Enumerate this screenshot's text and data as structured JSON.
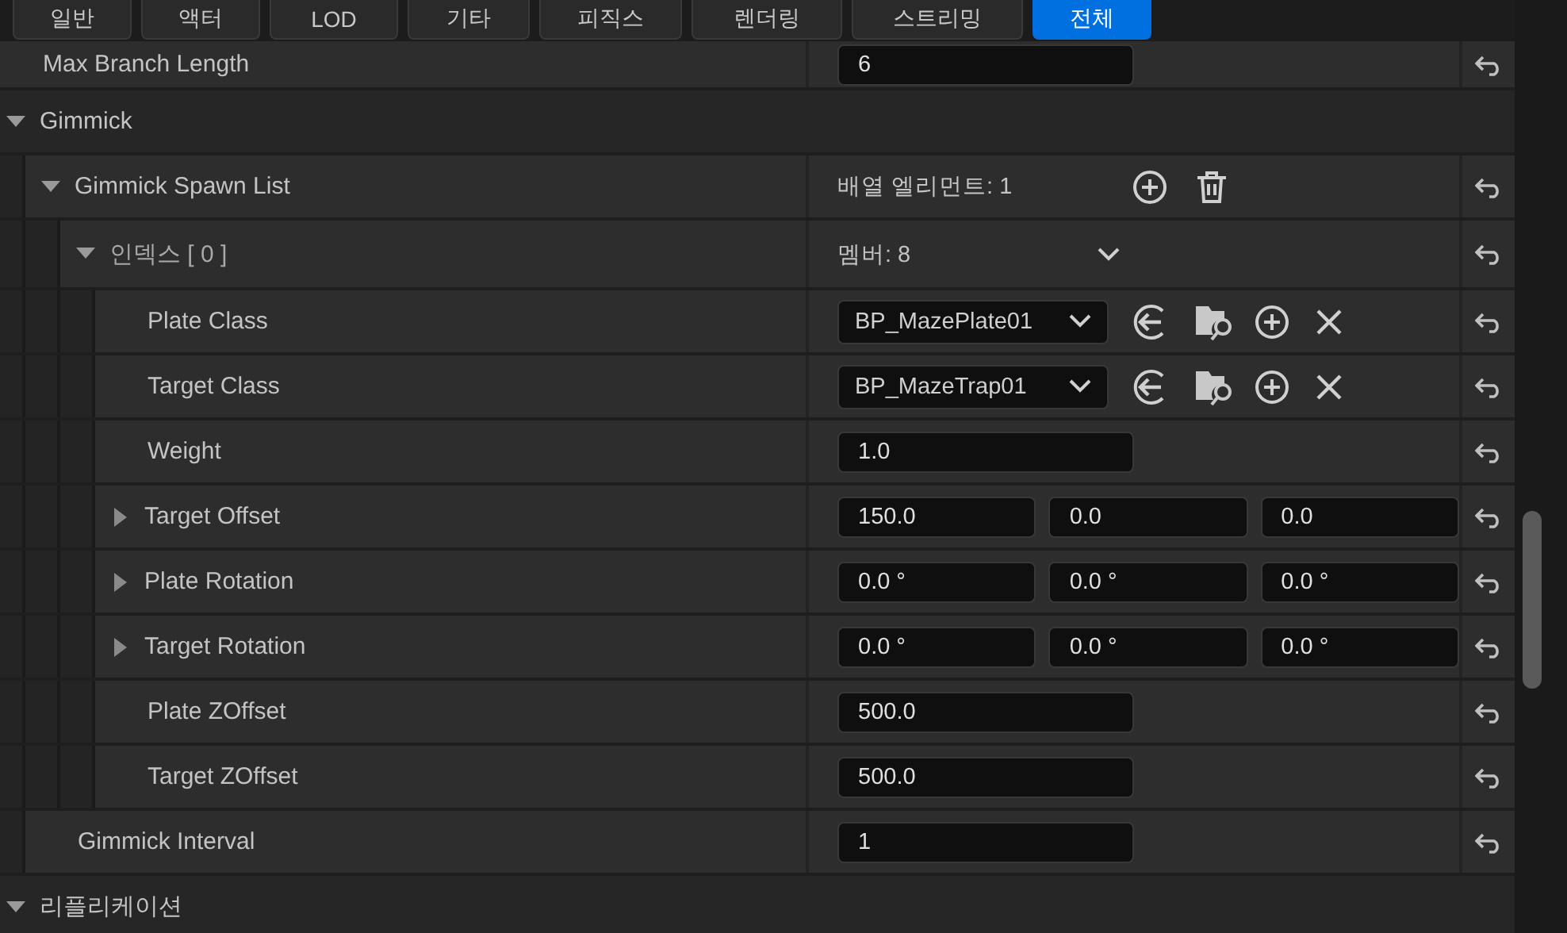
{
  "tabs": [
    {
      "label": "일반",
      "selected": false
    },
    {
      "label": "액터",
      "selected": false
    },
    {
      "label": "LOD",
      "selected": false
    },
    {
      "label": "기타",
      "selected": false
    },
    {
      "label": "피직스",
      "selected": false
    },
    {
      "label": "렌더링",
      "selected": false
    },
    {
      "label": "스트리밍",
      "selected": false
    },
    {
      "label": "전체",
      "selected": true
    }
  ],
  "rows": [
    {
      "kind": "property",
      "name": "Max Branch Length",
      "editor": {
        "kind": "number",
        "value": "6"
      }
    },
    {
      "kind": "category",
      "name": "Gimmick",
      "expanded": true,
      "children": [
        {
          "kind": "property",
          "name": "Gimmick Spawn List",
          "expanded": true,
          "editor": {
            "kind": "array",
            "text": "배열 엘리먼트: 1"
          },
          "children": [
            {
              "kind": "property",
              "name": "인덱스 [ 0 ]",
              "expanded": true,
              "editor": {
                "kind": "struct",
                "text": "멤버: 8"
              },
              "children": [
                {
                  "kind": "property",
                  "name": "Plate Class",
                  "editor": {
                    "kind": "class",
                    "value": "BP_MazePlate01"
                  }
                },
                {
                  "kind": "property",
                  "name": "Target Class",
                  "editor": {
                    "kind": "class",
                    "value": "BP_MazeTrap01"
                  }
                },
                {
                  "kind": "property",
                  "name": "Weight",
                  "editor": {
                    "kind": "number",
                    "value": "1.0"
                  }
                },
                {
                  "kind": "property",
                  "name": "Target Offset",
                  "expanded": false,
                  "editor": {
                    "kind": "vector",
                    "values": [
                      "150.0",
                      "0.0",
                      "0.0"
                    ]
                  }
                },
                {
                  "kind": "property",
                  "name": "Plate Rotation",
                  "expanded": false,
                  "editor": {
                    "kind": "vector",
                    "values": [
                      "0.0 °",
                      "0.0 °",
                      "0.0 °"
                    ]
                  }
                },
                {
                  "kind": "property",
                  "name": "Target Rotation",
                  "expanded": false,
                  "editor": {
                    "kind": "vector",
                    "values": [
                      "0.0 °",
                      "0.0 °",
                      "0.0 °"
                    ]
                  }
                },
                {
                  "kind": "property",
                  "name": "Plate ZOffset",
                  "editor": {
                    "kind": "number",
                    "value": "500.0"
                  }
                },
                {
                  "kind": "property",
                  "name": "Target ZOffset",
                  "editor": {
                    "kind": "number",
                    "value": "500.0"
                  }
                }
              ]
            }
          ]
        },
        {
          "kind": "property",
          "name": "Gimmick Interval",
          "editor": {
            "kind": "number",
            "value": "1"
          }
        }
      ]
    },
    {
      "kind": "category",
      "name": "리플리케이션",
      "expanded": true
    }
  ]
}
